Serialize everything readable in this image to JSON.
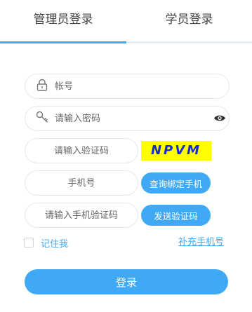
{
  "tabs": {
    "admin_login": "管理员登录",
    "student_login": "学员登录",
    "active": "admin_login"
  },
  "form": {
    "account": {
      "placeholder": "帐号",
      "value": "",
      "icon": "lock-icon"
    },
    "password": {
      "placeholder": "请输入密码",
      "value": "",
      "icon": "key-icon",
      "toggle_icon": "eye-icon"
    },
    "captcha": {
      "placeholder": "请输入验证码",
      "value": "",
      "image_text": "NPVM"
    },
    "phone": {
      "placeholder": "手机号",
      "value": "",
      "button_label": "查询绑定手机"
    },
    "sms_code": {
      "placeholder": "请输入手机验证码",
      "value": "",
      "button_label": "发送验证码"
    },
    "remember_me": {
      "label": "记住我",
      "checked": false
    },
    "add_phone_link": "补充手机号",
    "submit_label": "登录"
  },
  "colors": {
    "accent": "#3fa9f5",
    "captcha_bg": "#ffff00",
    "captcha_text": "#1a2bd6"
  }
}
